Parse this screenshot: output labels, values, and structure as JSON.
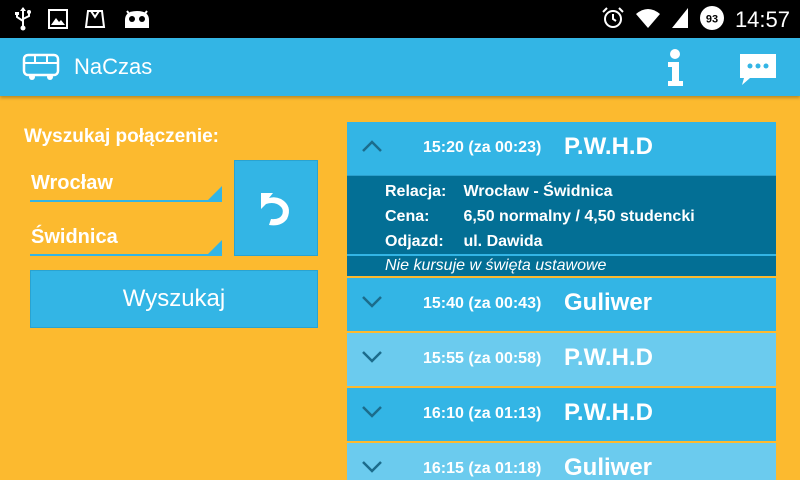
{
  "status_bar": {
    "time": "14:57",
    "battery": "93",
    "icons": [
      "usb-icon",
      "image-icon",
      "store-bag-icon",
      "android-icon",
      "alarm-icon",
      "wifi-icon",
      "signal-icon",
      "battery-icon"
    ]
  },
  "action_bar": {
    "title": "NaCzas",
    "app_icon": "bus-icon",
    "actions": [
      "info-icon",
      "message-icon"
    ]
  },
  "search": {
    "title": "Wyszukaj połączenie:",
    "from": "Wrocław",
    "to": "Świdnica",
    "swap_icon": "swap-arrow-icon",
    "button_label": "Wyszukaj"
  },
  "departures": {
    "expanded": {
      "time": "15:20 (za 00:23)",
      "carrier": "P.W.H.D",
      "relation_label": "Relacja:",
      "relation_value": "Wrocław - Świdnica",
      "price_label": "Cena:",
      "price_value": "6,50 normalny / 4,50 studencki",
      "departure_label": "Odjazd:",
      "departure_value": "ul. Dawida",
      "note": "Nie kursuje w święta ustawowe"
    },
    "rows": [
      {
        "time": "15:40 (za 00:43)",
        "carrier": "Guliwer"
      },
      {
        "time": "15:55 (za 00:58)",
        "carrier": "P.W.H.D"
      },
      {
        "time": "16:10 (za 01:13)",
        "carrier": "P.W.H.D"
      },
      {
        "time": "16:15 (za 01:18)",
        "carrier": "Guliwer"
      }
    ]
  },
  "colors": {
    "accent": "#33B5E5",
    "background": "#FCBA2F",
    "row_light": "#6BCBEE",
    "details_bg": "#036F95"
  }
}
